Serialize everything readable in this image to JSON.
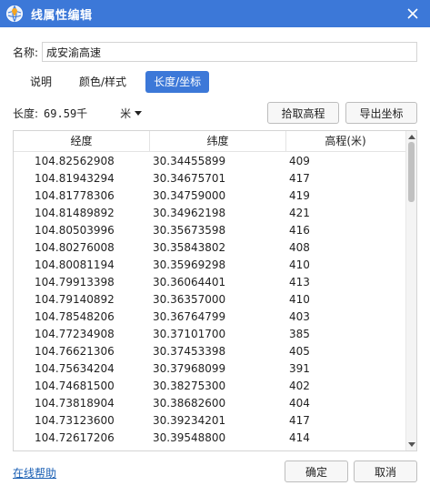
{
  "window": {
    "title": "线属性编辑"
  },
  "name_field": {
    "label": "名称:",
    "value": "成安渝高速"
  },
  "tabs": [
    {
      "label": "说明",
      "active": false
    },
    {
      "label": "颜色/样式",
      "active": false
    },
    {
      "label": "长度/坐标",
      "active": true
    }
  ],
  "length": {
    "label": "长度:",
    "value": "69.59千",
    "unit": "米"
  },
  "buttons": {
    "pick_elevation": "拾取高程",
    "export_coords": "导出坐标",
    "ok": "确定",
    "cancel": "取消"
  },
  "table": {
    "headers": [
      "经度",
      "纬度",
      "高程(米)"
    ],
    "rows": [
      [
        "104.82562908",
        "30.34455899",
        "409"
      ],
      [
        "104.81943294",
        "30.34675701",
        "417"
      ],
      [
        "104.81778306",
        "30.34759000",
        "419"
      ],
      [
        "104.81489892",
        "30.34962198",
        "421"
      ],
      [
        "104.80503996",
        "30.35673598",
        "416"
      ],
      [
        "104.80276008",
        "30.35843802",
        "408"
      ],
      [
        "104.80081194",
        "30.35969298",
        "410"
      ],
      [
        "104.79913398",
        "30.36064401",
        "413"
      ],
      [
        "104.79140892",
        "30.36357000",
        "410"
      ],
      [
        "104.78548206",
        "30.36764799",
        "403"
      ],
      [
        "104.77234908",
        "30.37101700",
        "385"
      ],
      [
        "104.76621306",
        "30.37453398",
        "405"
      ],
      [
        "104.75634204",
        "30.37968099",
        "391"
      ],
      [
        "104.74681500",
        "30.38275300",
        "402"
      ],
      [
        "104.73818904",
        "30.38682600",
        "404"
      ],
      [
        "104.73123600",
        "30.39234201",
        "417"
      ],
      [
        "104.72617206",
        "30.39548800",
        "414"
      ]
    ]
  },
  "footer": {
    "help": "在线帮助"
  },
  "colors": {
    "accent": "#3c78d8",
    "link": "#1a5fb4"
  }
}
